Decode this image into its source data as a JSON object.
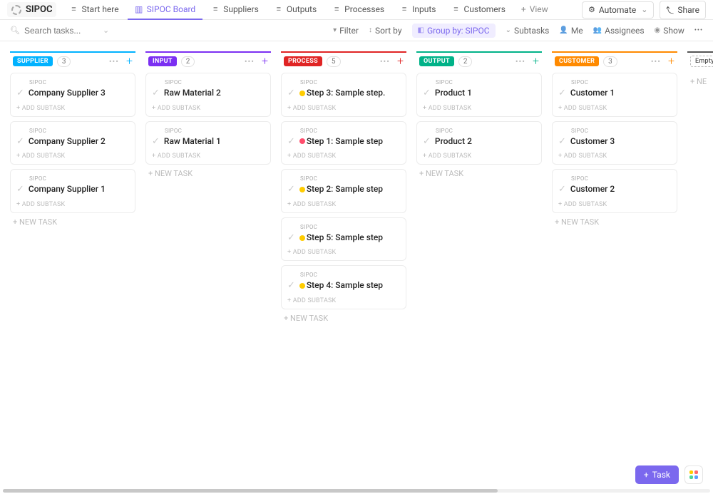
{
  "header": {
    "title": "SIPOC",
    "tabs": [
      {
        "label": "Start here"
      },
      {
        "label": "SIPOC Board"
      },
      {
        "label": "Suppliers"
      },
      {
        "label": "Outputs"
      },
      {
        "label": "Processes"
      },
      {
        "label": "Inputs"
      },
      {
        "label": "Customers"
      }
    ],
    "view_label": "View",
    "automate_label": "Automate",
    "share_label": "Share"
  },
  "toolbar": {
    "search_placeholder": "Search tasks...",
    "filter": "Filter",
    "sort": "Sort by",
    "group": "Group by: SIPOC",
    "subtasks": "Subtasks",
    "me": "Me",
    "assignees": "Assignees",
    "show": "Show"
  },
  "columns": [
    {
      "key": "supplier",
      "label": "SUPPLIER",
      "count": "3",
      "cards": [
        {
          "tag": "SIPOC",
          "title": "Company Supplier 3"
        },
        {
          "tag": "SIPOC",
          "title": "Company Supplier 2"
        },
        {
          "tag": "SIPOC",
          "title": "Company Supplier 1"
        }
      ]
    },
    {
      "key": "input",
      "label": "INPUT",
      "count": "2",
      "cards": [
        {
          "tag": "SIPOC",
          "title": "Raw Material 2"
        },
        {
          "tag": "SIPOC",
          "title": "Raw Material 1"
        }
      ]
    },
    {
      "key": "process",
      "label": "PROCESS",
      "count": "5",
      "cards": [
        {
          "tag": "SIPOC",
          "title": "Step 3: Sample step.",
          "status": "yellow"
        },
        {
          "tag": "SIPOC",
          "title": "Step 1: Sample step",
          "status": "red"
        },
        {
          "tag": "SIPOC",
          "title": "Step 2: Sample step",
          "status": "yellow"
        },
        {
          "tag": "SIPOC",
          "title": "Step 5: Sample step",
          "status": "yellow"
        },
        {
          "tag": "SIPOC",
          "title": "Step 4: Sample step",
          "status": "yellow"
        }
      ]
    },
    {
      "key": "output",
      "label": "OUTPUT",
      "count": "2",
      "cards": [
        {
          "tag": "SIPOC",
          "title": "Product 1"
        },
        {
          "tag": "SIPOC",
          "title": "Product 2"
        }
      ]
    },
    {
      "key": "customer",
      "label": "CUSTOMER",
      "count": "3",
      "cards": [
        {
          "tag": "SIPOC",
          "title": "Customer 1"
        },
        {
          "tag": "SIPOC",
          "title": "Customer 3"
        },
        {
          "tag": "SIPOC",
          "title": "Customer 2"
        }
      ]
    },
    {
      "key": "empty",
      "label": "Empty",
      "count": "",
      "cards": []
    }
  ],
  "strings": {
    "add_subtask": "+ ADD SUBTASK",
    "new_task": "+ NEW TASK",
    "new_task_short": "+ NE",
    "task_button": "Task"
  }
}
